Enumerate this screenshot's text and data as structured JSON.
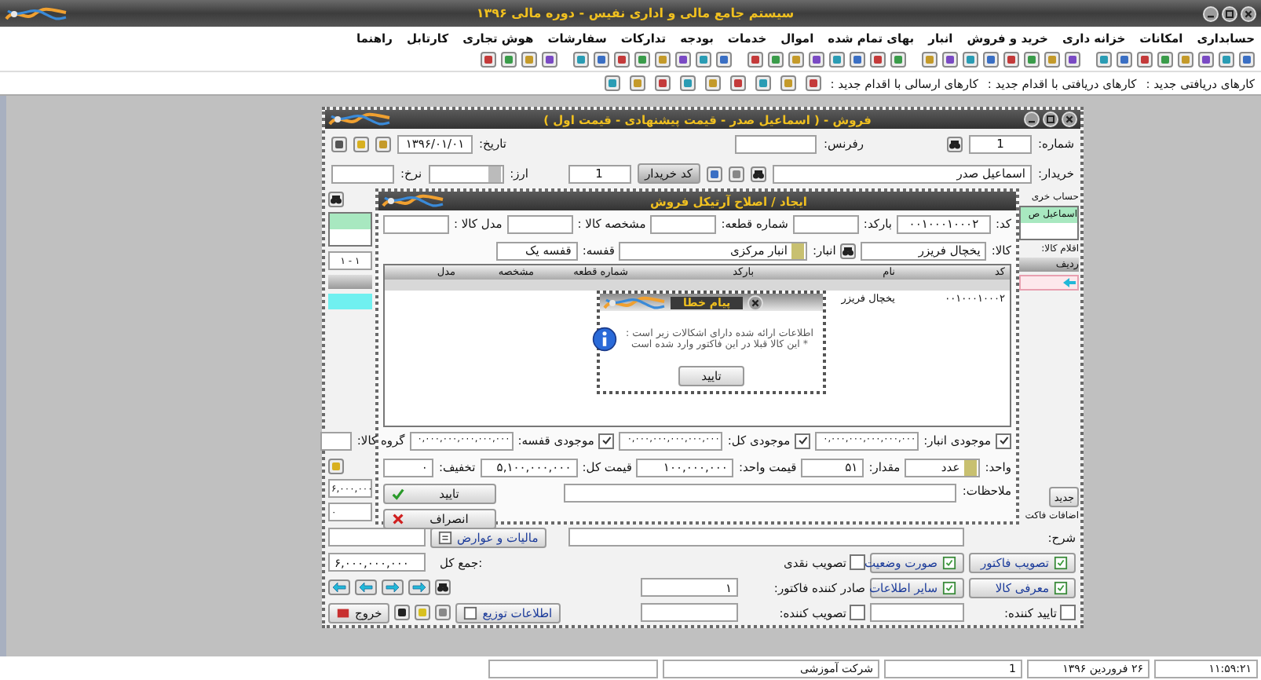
{
  "app": {
    "title": "سیستم جامع مالی و اداری نفیس - دوره مالی ۱۳۹۶"
  },
  "menu": [
    "حسابداری",
    "امکانات",
    "خزانه داری",
    "خرید و فروش",
    "انبار",
    "بهای تمام شده",
    "اموال",
    "خدمات",
    "بودجه",
    "تدارکات",
    "سفارشات",
    "هوش تجاری",
    "کارتابل",
    "راهنما"
  ],
  "cartable": [
    "کارهای دریافتی جدید :",
    "کارهای دریافتی با اقدام جدید :",
    "کارهای ارسالی با اقدام جدید :"
  ],
  "sales_window": {
    "title": "فروش - ( اسماعیل صدر - قیمت پیشنهادی - قیمت اول )",
    "number": {
      "label": "شماره:",
      "value": "1"
    },
    "reference": {
      "label": "رفرنس:"
    },
    "date": {
      "label": "تاریخ:",
      "value": "۱۳۹۶/۰۱/۰۱"
    },
    "buyer": {
      "label": "خریدار:",
      "value": "اسماعیل صدر"
    },
    "buyer_code": {
      "button": "کد خریدار",
      "value": "1"
    },
    "currency": {
      "label": "ارز:"
    },
    "rate": {
      "label": "نرخ:"
    },
    "account": {
      "label": "حساب خری",
      "rows": [
        {
          "text": "اسماعیل ص",
          "selected": true
        }
      ]
    },
    "counter": "۱ - ۱",
    "items": {
      "label": "اقلام کالا:",
      "header": "ردیف",
      "rows": [
        {
          "selected": true
        }
      ]
    },
    "new_button": "جدید",
    "additions": {
      "label": "اضافات فاکت",
      "value": "۶,۰۰۰,۰۰۰",
      "amount": "۰"
    },
    "tax_button": "مالیات و عوارض",
    "grand_total": {
      "label": "جمع کل:",
      "value": "۶,۰۰۰,۰۰۰,۰۰۰"
    },
    "description_label": "شرح:",
    "buttons": [
      "تصویب فاکتور",
      "صورت وضعیت",
      "معرفی کالا",
      "سایر اطلاعات"
    ],
    "cash_approval": {
      "label": "تصویب نقدی",
      "checked": false
    },
    "issuer": {
      "label": "صادر کننده فاکتور:",
      "value": "۱"
    },
    "confirmer": {
      "label": "تایید کننده:",
      "checked": false
    },
    "approver": {
      "label": "تصویب کننده:",
      "checked": false
    },
    "exit_button": "خروج",
    "distribution_button": "اطلاعات توزیع"
  },
  "item_dialog": {
    "title": "ایجاد / اصلاح آرتیکل فروش",
    "code": {
      "label": "کد:",
      "value": "۰۰۱۰۰۰۱۰۰۰۲"
    },
    "barcode_label": "بارکد:",
    "part_label": "شماره قطعه:",
    "spec_label": "مشخصه کالا :",
    "model_label": "مدل کالا :",
    "product": {
      "label": "کالا:",
      "value": "یخچال فریزر"
    },
    "warehouse": {
      "label": "انبار:",
      "value": "انبار مرکزی"
    },
    "shelf": {
      "label": "قفسه:",
      "value": "قفسه یک"
    },
    "table": {
      "columns": [
        "کد",
        "نام",
        "بارکد",
        "شماره قطعه",
        "مشخصه",
        "مدل"
      ],
      "rows": [
        [
          "۰۰۱۰۰۰۱۰۰۰۲",
          "یخچال فریزر"
        ]
      ]
    },
    "stock": [
      {
        "label": "موجودی انبار:",
        "checked": true,
        "value": "۰,۰۰۰,۰۰۰,۰۰۰,۰۰۰,۰۰۰"
      },
      {
        "label": "موجودی کل:",
        "checked": true,
        "value": "۰,۰۰۰,۰۰۰,۰۰۰,۰۰۰,۰۰۰"
      },
      {
        "label": "موجودی قفسه:",
        "checked": true,
        "value": "۰,۰۰۰,۰۰۰,۰۰۰,۰۰۰,۰۰۰"
      }
    ],
    "group_label": "گروه کالا:",
    "unit": {
      "label": "واحد:",
      "value": "عدد"
    },
    "quantity": {
      "label": "مقدار:",
      "value": "۵۱"
    },
    "unit_price": {
      "label": "قیمت واحد:",
      "value": "۱۰۰,۰۰۰,۰۰۰"
    },
    "total_price": {
      "label": "قیمت کل:",
      "value": "۵,۱۰۰,۰۰۰,۰۰۰"
    },
    "discount": {
      "label": "تخفیف:",
      "value": "۰"
    },
    "ok_button": "تایید",
    "cancel_button": "انصراف",
    "notes_label": "ملاحظات:"
  },
  "message_box": {
    "title": "پیام خطا",
    "lines": [
      "اطلاعات ارائه شده دارای اشکالات زیر است :",
      "* این کالا قبلا در این فاکتور وارد شده است"
    ],
    "button": "تایید"
  },
  "status_bar": [
    "۱۱:۵۹:۲۱",
    "۲۶ فروردین ۱۳۹۶",
    "1",
    "شرکت آموزشی"
  ]
}
